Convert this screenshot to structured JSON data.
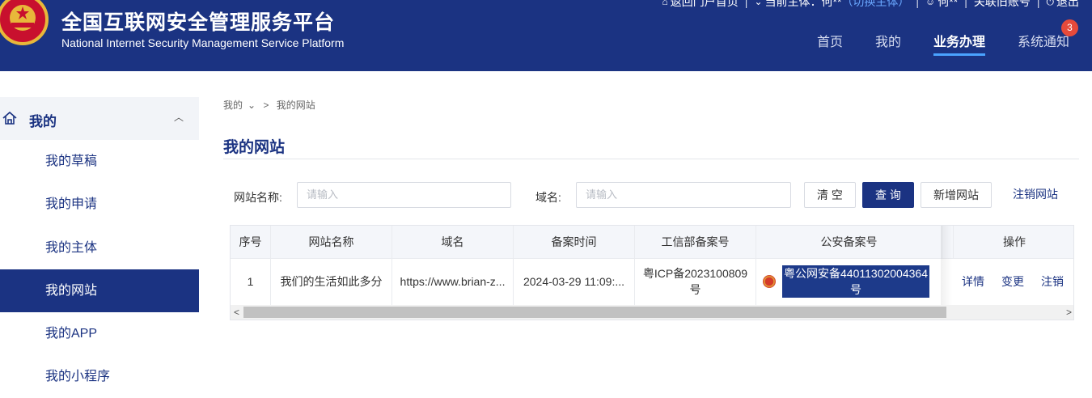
{
  "header": {
    "title_cn": "全国互联网安全管理服务平台",
    "title_en": "National Internet Security Management Service Platform",
    "topbar": {
      "back_home": "返回门户首页",
      "current_subject_label": "当前主体：",
      "current_subject_value": "何**",
      "switch_subject": "（切换主体）",
      "user": "何**",
      "link_old_account": "关联旧账号",
      "logout": "退出"
    },
    "nav": [
      "首页",
      "我的",
      "业务办理",
      "系统通知"
    ],
    "notification_count": "3",
    "colors": {
      "primary": "#1b3382",
      "badge": "#e64a3b",
      "active_underline": "#4aa3ff"
    }
  },
  "sidebar": {
    "group_label": "我的",
    "items": [
      "我的草稿",
      "我的申请",
      "我的主体",
      "我的网站",
      "我的APP",
      "我的小程序"
    ],
    "active_item": "我的网站"
  },
  "breadcrumb": {
    "level1": "我的",
    "separator": ">",
    "level2": "我的网站"
  },
  "page_title": "我的网站",
  "filters": {
    "site_name_label": "网站名称:",
    "site_name_placeholder": "请输入",
    "domain_label": "域名:",
    "domain_placeholder": "请输入",
    "clear_button": "清 空",
    "query_button": "查 询",
    "add_button": "新增网站",
    "cancel_link": "注销网站"
  },
  "table": {
    "columns": [
      "序号",
      "网站名称",
      "域名",
      "备案时间",
      "工信部备案号",
      "公安备案号",
      "操作"
    ],
    "rows": [
      {
        "index": "1",
        "site_name": "我们的生活如此多分",
        "domain": "https://www.brian-z...",
        "record_time": "2024-03-29 11:09:...",
        "miit_line1": "粤ICP备2023100809",
        "miit_line2": "号",
        "police_line1": "粤公网安备44011302004364",
        "police_line2": "号",
        "actions": [
          "详情",
          "变更",
          "注销"
        ]
      }
    ]
  }
}
